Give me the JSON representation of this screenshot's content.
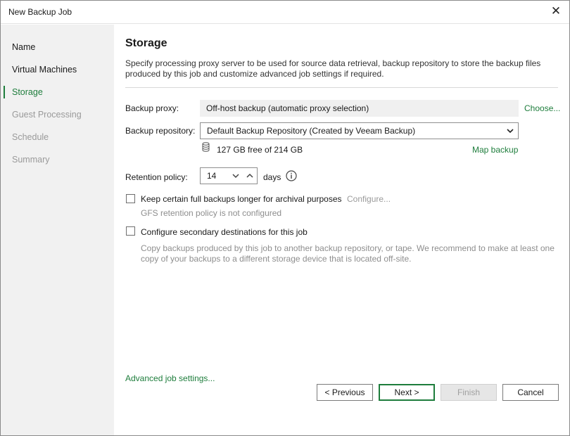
{
  "window": {
    "title": "New Backup Job"
  },
  "sidebar": {
    "items": [
      {
        "label": "Name"
      },
      {
        "label": "Virtual Machines"
      },
      {
        "label": "Storage"
      },
      {
        "label": "Guest Processing"
      },
      {
        "label": "Schedule"
      },
      {
        "label": "Summary"
      }
    ]
  },
  "main": {
    "heading": "Storage",
    "description": "Specify processing proxy server to be used for source data retrieval, backup repository to store the backup files produced by this job and customize advanced job settings if required.",
    "proxy": {
      "label": "Backup proxy:",
      "value": "Off-host backup (automatic proxy selection)",
      "choose": "Choose..."
    },
    "repository": {
      "label": "Backup repository:",
      "value": "Default Backup Repository (Created by Veeam Backup)",
      "free": "127 GB free of 214 GB",
      "map": "Map backup"
    },
    "retention": {
      "label": "Retention policy:",
      "value": "14",
      "unit": "days"
    },
    "archival": {
      "label": "Keep certain full backups longer for archival purposes",
      "configure": "Configure...",
      "note": "GFS retention policy is not configured",
      "checked": false
    },
    "secondary": {
      "label": "Configure secondary destinations for this job",
      "note_line1": "Copy backups produced by this job to another backup repository, or tape. We recommend to make at least one",
      "note_line2": "copy of your backups to a different storage device that is located off-site.",
      "checked": false
    },
    "advanced": "Advanced job settings..."
  },
  "buttons": {
    "previous": "< Previous",
    "next": "Next >",
    "finish": "Finish",
    "cancel": "Cancel"
  },
  "colors": {
    "accent": "#1e7d3c",
    "sidebar_bg": "#f1f1f1",
    "disabled_text": "#9a9a9a"
  }
}
